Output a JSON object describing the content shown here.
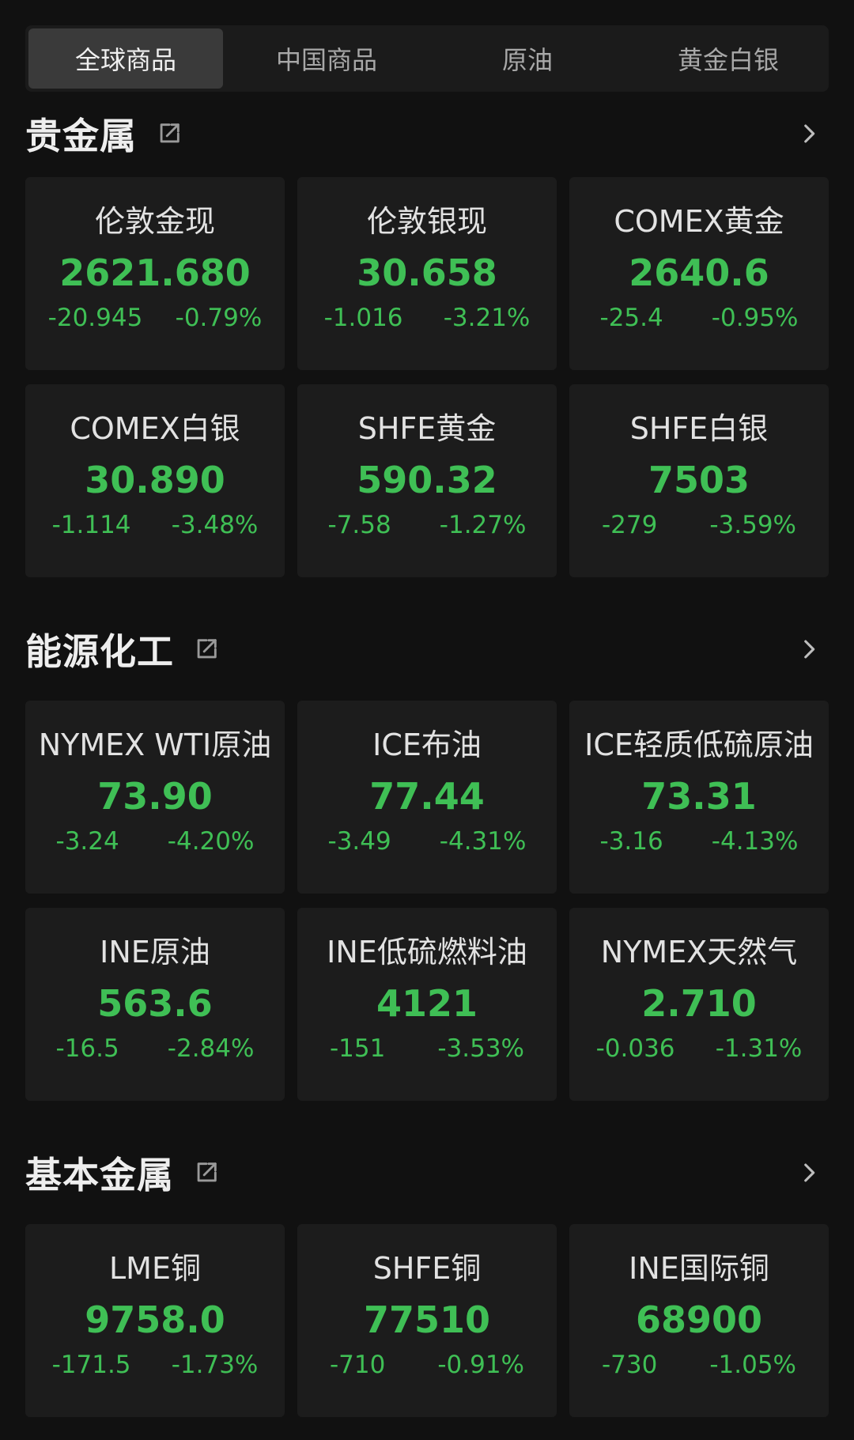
{
  "tabs": [
    {
      "label": "全球商品",
      "active": true
    },
    {
      "label": "中国商品",
      "active": false
    },
    {
      "label": "原油",
      "active": false
    },
    {
      "label": "黄金白银",
      "active": false
    }
  ],
  "colors": {
    "background": "#111111",
    "card": "#1c1c1c",
    "down_green": "#3fbf55"
  },
  "sections": [
    {
      "title": "贵金属",
      "icon": "share-icon",
      "items": [
        {
          "name": "伦敦金现",
          "price": "2621.680",
          "change": "-20.945",
          "pct": "-0.79%"
        },
        {
          "name": "伦敦银现",
          "price": "30.658",
          "change": "-1.016",
          "pct": "-3.21%"
        },
        {
          "name": "COMEX黄金",
          "price": "2640.6",
          "change": "-25.4",
          "pct": "-0.95%"
        },
        {
          "name": "COMEX白银",
          "price": "30.890",
          "change": "-1.114",
          "pct": "-3.48%"
        },
        {
          "name": "SHFE黄金",
          "price": "590.32",
          "change": "-7.58",
          "pct": "-1.27%"
        },
        {
          "name": "SHFE白银",
          "price": "7503",
          "change": "-279",
          "pct": "-3.59%"
        }
      ]
    },
    {
      "title": "能源化工",
      "icon": "share-icon",
      "items": [
        {
          "name": "NYMEX WTI原油",
          "price": "73.90",
          "change": "-3.24",
          "pct": "-4.20%"
        },
        {
          "name": "ICE布油",
          "price": "77.44",
          "change": "-3.49",
          "pct": "-4.31%"
        },
        {
          "name": "ICE轻质低硫原油",
          "price": "73.31",
          "change": "-3.16",
          "pct": "-4.13%"
        },
        {
          "name": "INE原油",
          "price": "563.6",
          "change": "-16.5",
          "pct": "-2.84%"
        },
        {
          "name": "INE低硫燃料油",
          "price": "4121",
          "change": "-151",
          "pct": "-3.53%"
        },
        {
          "name": "NYMEX天然气",
          "price": "2.710",
          "change": "-0.036",
          "pct": "-1.31%"
        }
      ]
    },
    {
      "title": "基本金属",
      "icon": "share-icon",
      "items": [
        {
          "name": "LME铜",
          "price": "9758.0",
          "change": "-171.5",
          "pct": "-1.73%"
        },
        {
          "name": "SHFE铜",
          "price": "77510",
          "change": "-710",
          "pct": "-0.91%"
        },
        {
          "name": "INE国际铜",
          "price": "68900",
          "change": "-730",
          "pct": "-1.05%"
        }
      ]
    }
  ]
}
